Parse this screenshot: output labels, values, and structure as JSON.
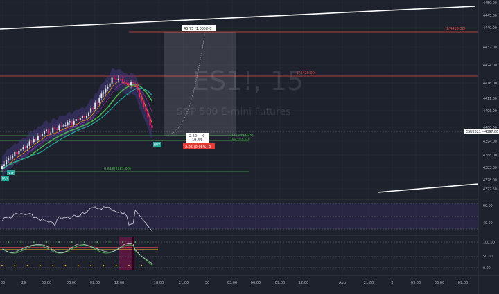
{
  "watermark": {
    "symbol": "ES1!, 15",
    "name": "S&P 500 E-mini Futures"
  },
  "price_axis": [
    "4450.00",
    "4445.00",
    "4440.00",
    "4432.00",
    "4424.00",
    "4416.00",
    "4411.00",
    "4406.00",
    "4400.00",
    "4394.00",
    "4388.00",
    "4383.00",
    "4378.00",
    "4372.50"
  ],
  "current_price": {
    "label": "ESU2021 – 4397.00",
    "value": 4397.0
  },
  "time_axis": [
    "00",
    "29",
    "03:00",
    "06:00",
    "09:00",
    "12:00",
    "18:00",
    "21:00",
    "30",
    "03:00",
    "06:00",
    "09:00",
    "12:00",
    "Aug",
    "21:00",
    "2",
    "03:00",
    "06:00",
    "09:00"
  ],
  "osc1_axis": [
    "60.00",
    "40.00"
  ],
  "osc2_axis": [
    "100.00",
    "50.00",
    "0.00"
  ],
  "annotations": {
    "measure_up": "43.75 (1.00%) 0",
    "level_4440": "1(4438.50)",
    "level_4420": "1(4420.00)",
    "fib_0618": "0.618(4381.00)",
    "fib_0236": "0.0(4397.75)",
    "fib_0": "0(4393.50)",
    "entry_box": "2.50 — 0",
    "entry_box2": "19.44",
    "loss_box": "2.25 (0.05%) 0",
    "buy_marker": "BUY"
  },
  "colors": {
    "background": "#1e222d",
    "grid": "#2a2e39",
    "up": "#e6e6e6",
    "down": "#e91e63",
    "red_line": "#e04848",
    "green_line": "#4caf50",
    "band": "#4a3b8c"
  }
}
